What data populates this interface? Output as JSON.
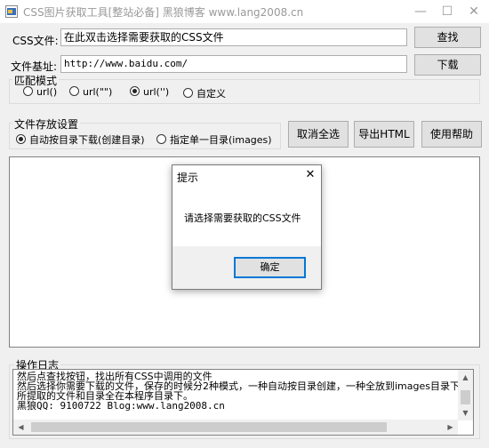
{
  "window": {
    "title": "CSS图片获取工具[整站必备] 黑狼博客 www.lang2008.cn",
    "minimize_glyph": "—",
    "maximize_glyph": "☐",
    "close_glyph": "✕"
  },
  "css_file": {
    "label": "CSS文件:",
    "value": "在此双击选择需要获取的CSS文件",
    "button": "查找"
  },
  "base_url": {
    "label": "文件基址:",
    "value": "http://www.baidu.com/",
    "button": "下载"
  },
  "match_mode": {
    "title": "匹配模式",
    "options": [
      {
        "label": "url()",
        "selected": false
      },
      {
        "label": "url(\"\")",
        "selected": false
      },
      {
        "label": "url('')",
        "selected": true
      },
      {
        "label": "自定义",
        "selected": false
      }
    ]
  },
  "storage": {
    "title": "文件存放设置",
    "options": [
      {
        "label": "自动按目录下载(创建目录)",
        "selected": true
      },
      {
        "label": "指定单一目录(images)",
        "selected": false
      }
    ]
  },
  "buttons": {
    "deselect_all": "取消全选",
    "export_html": "导出HTML",
    "help": "使用帮助"
  },
  "dialog": {
    "title": "提示",
    "message": "请选择需要获取的CSS文件",
    "ok": "确定",
    "close_glyph": "✕"
  },
  "log": {
    "title": "操作日志",
    "lines": [
      "然后点查找按钮，找出所有CSS中调用的文件",
      "然后选择你需要下载的文件，保存的时候分2种模式，一种自动按目录创建，一种全放到images目录下",
      "所提取的文件和目录全在本程序目录下。",
      "    黑狼QQ: 9100722 Blog:www.lang2008.cn"
    ]
  }
}
